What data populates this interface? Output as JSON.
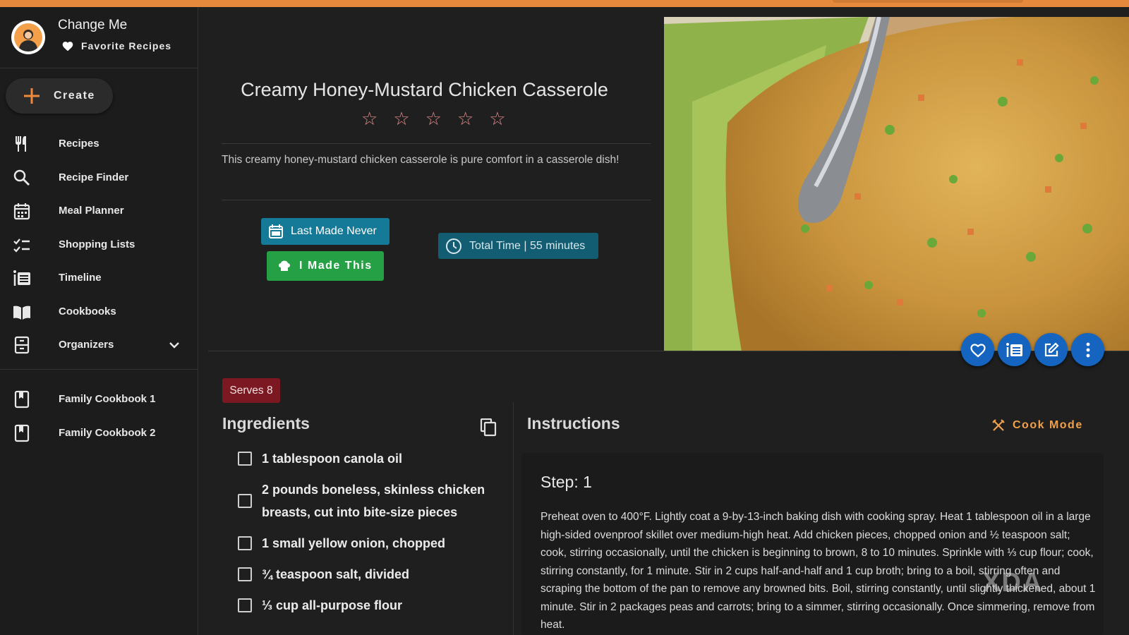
{
  "user": {
    "name": "Change Me",
    "favorites_label": "Favorite Recipes"
  },
  "sidebar": {
    "create_label": "Create",
    "items": [
      {
        "label": "Recipes",
        "icon": "fork-knife-icon"
      },
      {
        "label": "Recipe Finder",
        "icon": "search-icon"
      },
      {
        "label": "Meal Planner",
        "icon": "calendar-icon"
      },
      {
        "label": "Shopping Lists",
        "icon": "checklist-icon"
      },
      {
        "label": "Timeline",
        "icon": "timeline-icon"
      },
      {
        "label": "Cookbooks",
        "icon": "book-open-icon"
      },
      {
        "label": "Organizers",
        "icon": "organizer-icon"
      }
    ],
    "cookbooks": [
      {
        "label": "Family Cookbook 1"
      },
      {
        "label": "Family Cookbook 2"
      }
    ]
  },
  "recipe": {
    "title": "Creamy Honey-Mustard Chicken Casserole",
    "rating_stars": 5,
    "description": "This creamy honey-mustard chicken casserole is pure comfort in a casserole dish!",
    "last_made": "Last Made Never",
    "made_this": "I Made This",
    "total_time": "Total Time | 55 minutes",
    "serves": "Serves 8"
  },
  "ingredients": {
    "heading": "Ingredients",
    "items": [
      "1 tablespoon canola oil",
      "2 pounds boneless, skinless chicken breasts, cut into bite-size pieces",
      "1 small yellow onion, chopped",
      "¾ teaspoon salt, divided",
      "⅓ cup all-purpose flour"
    ]
  },
  "instructions": {
    "heading": "Instructions",
    "cook_mode": "Cook Mode",
    "step_title": "Step: 1",
    "step_text": "Preheat oven to 400°F. Lightly coat a 9-by-13-inch baking dish with cooking spray. Heat 1 tablespoon oil in a large high-sided ovenproof skillet over medium-high heat. Add chicken pieces, chopped onion and ½ teaspoon salt; cook, stirring occasionally, until the chicken is beginning to brown, 8 to 10 minutes. Sprinkle with ⅓ cup flour; cook, stirring constantly, for 1 minute. Stir in 2 cups half-and-half and 1 cup broth; bring to a boil, stirring often and scraping the bottom of the pan to remove any browned bits. Boil, stirring constantly, until slightly thickened, about 1 minute. Stir in 2 packages peas and carrots; bring to a simmer, stirring occasionally. Once simmering, remove from heat."
  },
  "watermark": "XDA",
  "colors": {
    "accent_orange": "#e58a3c",
    "blue_button": "#157a98",
    "green_button": "#25a045",
    "fab_blue": "#1565c0",
    "serves_badge": "#7b1822"
  }
}
